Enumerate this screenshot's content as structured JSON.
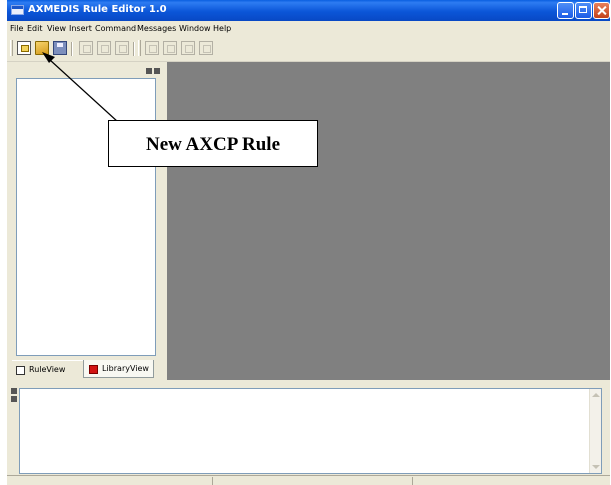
{
  "window": {
    "title": "AXMEDIS Rule Editor 1.0",
    "title_icon": "app-window-icon",
    "controls": [
      "minimize-icon",
      "maximize-icon",
      "close-icon"
    ]
  },
  "menubar": {
    "items": [
      "File",
      "Edit",
      "View",
      "Insert",
      "Command",
      "Messages",
      "Window",
      "Help"
    ]
  },
  "toolbar": {
    "buttons": [
      "new-rule-icon",
      "open-icon",
      "save-icon",
      "cut-icon",
      "copy-icon",
      "paste-icon",
      "property-icon",
      "edit-icon",
      "run-icon",
      "zoom-icon"
    ]
  },
  "left_panel": {
    "tabs": [
      {
        "label": "RuleView",
        "icon": "ruleview-icon"
      },
      {
        "label": "LibraryView",
        "icon": "libraryview-icon"
      }
    ]
  },
  "callout": {
    "text": "New AXCP Rule"
  },
  "colors": {
    "titlebar": "#0b56d8",
    "chrome": "#ece9d8",
    "mdi_background": "#808080",
    "panel_border": "#7f9db9",
    "libraryview_icon": "#d21414"
  }
}
